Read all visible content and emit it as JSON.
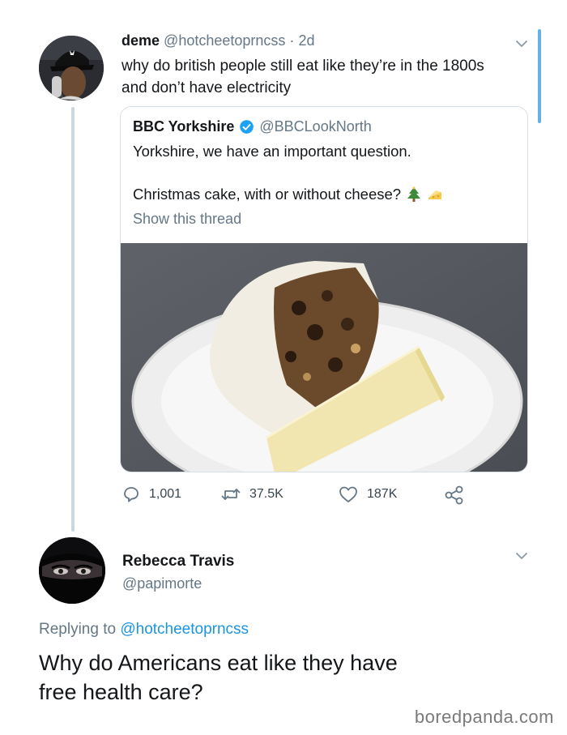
{
  "tweet": {
    "display_name": "deme",
    "handle": "@hotcheetoprncss",
    "separator": "·",
    "time": "2d",
    "text_line1": "why do british people still eat like they’re in the 1800s",
    "text_line2": "and don’t have electricity"
  },
  "quoted": {
    "display_name": "BBC Yorkshire",
    "handle": "@BBCLookNorth",
    "text_line1": "Yorkshire, we have an important question.",
    "text_line2": "Christmas cake, with or without cheese?",
    "emojis": [
      "christmas-tree",
      "cheese"
    ],
    "show_thread": "Show this thread"
  },
  "actions": {
    "replies": "1,001",
    "retweets": "37.5K",
    "likes": "187K"
  },
  "reply": {
    "display_name": "Rebecca Travis",
    "handle": "@papimorte",
    "replying_prefix": "Replying to",
    "replying_to": "@hotcheetoprncss",
    "text_line1": "Why do Americans eat like they have",
    "text_line2": "free health care?"
  },
  "watermark": "boredpanda.com",
  "colors": {
    "link": "#1b95e0",
    "muted": "#657786",
    "verified": "#1da1f2",
    "thread_line": "#ccd6dd"
  }
}
